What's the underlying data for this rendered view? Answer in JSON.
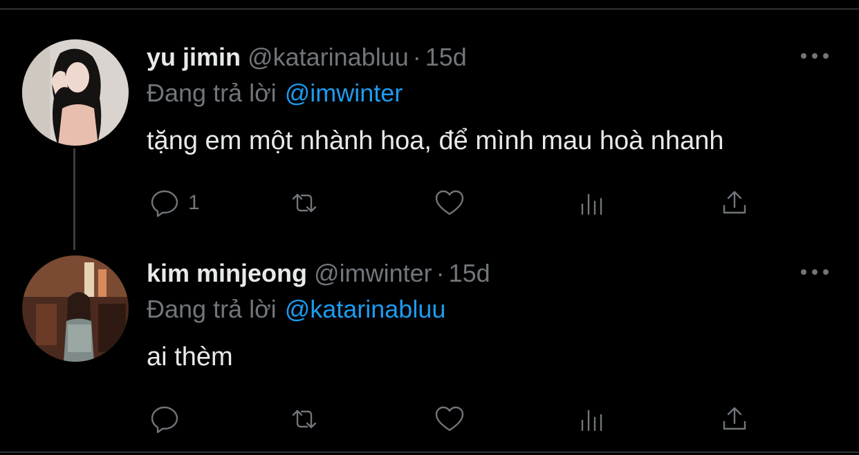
{
  "tweets": [
    {
      "name": "yu jimin",
      "handle": "@katarinabluu",
      "separator": "·",
      "time": "15d",
      "reply_label": "Đang trả lời",
      "reply_target": "@imwinter",
      "text": "tặng em một nhành hoa, để mình mau hoà nhanh",
      "reply_count": "1"
    },
    {
      "name": "kim minjeong",
      "handle": "@imwinter",
      "separator": "·",
      "time": "15d",
      "reply_label": "Đang trả lời",
      "reply_target": "@katarinabluu",
      "text": "ai thèm",
      "reply_count": ""
    }
  ],
  "icons": {
    "reply": "speech-bubble-icon",
    "retweet": "retweet-icon",
    "like": "heart-icon",
    "views": "bar-chart-icon",
    "share": "share-upload-icon",
    "more": "ellipsis-icon"
  },
  "colors": {
    "background": "#000000",
    "text": "#e7e9ea",
    "muted": "#71767b",
    "link": "#1d9bf0"
  }
}
